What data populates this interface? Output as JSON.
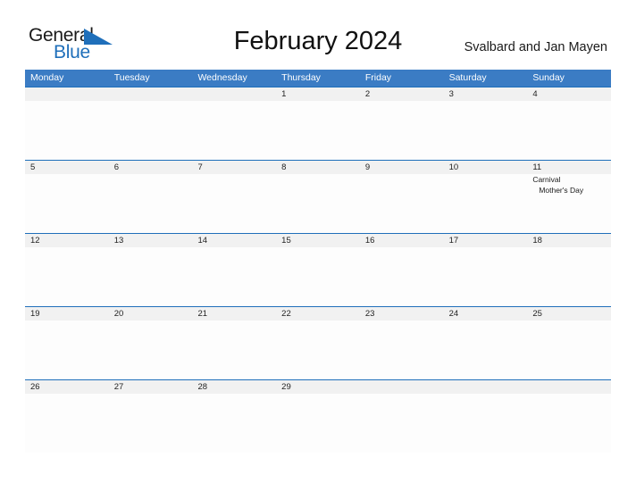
{
  "brand": {
    "name_top": "General",
    "name_bottom": "Blue",
    "triangle_icon": "triangle-flag-icon",
    "top_color": "#1a1a1a",
    "bottom_color": "#1f6fba"
  },
  "header": {
    "title": "February 2024",
    "region": "Svalbard and Jan Mayen"
  },
  "theme": {
    "header_blue": "#3b7cc4",
    "rule_blue": "#1f6fba",
    "date_band_gray": "#f1f1f1",
    "page_background": "#ffffff"
  },
  "calendar": {
    "weekdays": [
      "Monday",
      "Tuesday",
      "Wednesday",
      "Thursday",
      "Friday",
      "Saturday",
      "Sunday"
    ],
    "weeks": [
      {
        "days": [
          {
            "date": "",
            "events": []
          },
          {
            "date": "",
            "events": []
          },
          {
            "date": "",
            "events": []
          },
          {
            "date": "1",
            "events": []
          },
          {
            "date": "2",
            "events": []
          },
          {
            "date": "3",
            "events": []
          },
          {
            "date": "4",
            "events": []
          }
        ]
      },
      {
        "days": [
          {
            "date": "5",
            "events": []
          },
          {
            "date": "6",
            "events": []
          },
          {
            "date": "7",
            "events": []
          },
          {
            "date": "8",
            "events": []
          },
          {
            "date": "9",
            "events": []
          },
          {
            "date": "10",
            "events": []
          },
          {
            "date": "11",
            "events": [
              "Carnival",
              "Mother's Day"
            ]
          }
        ]
      },
      {
        "days": [
          {
            "date": "12",
            "events": []
          },
          {
            "date": "13",
            "events": []
          },
          {
            "date": "14",
            "events": []
          },
          {
            "date": "15",
            "events": []
          },
          {
            "date": "16",
            "events": []
          },
          {
            "date": "17",
            "events": []
          },
          {
            "date": "18",
            "events": []
          }
        ]
      },
      {
        "days": [
          {
            "date": "19",
            "events": []
          },
          {
            "date": "20",
            "events": []
          },
          {
            "date": "21",
            "events": []
          },
          {
            "date": "22",
            "events": []
          },
          {
            "date": "23",
            "events": []
          },
          {
            "date": "24",
            "events": []
          },
          {
            "date": "25",
            "events": []
          }
        ]
      },
      {
        "days": [
          {
            "date": "26",
            "events": []
          },
          {
            "date": "27",
            "events": []
          },
          {
            "date": "28",
            "events": []
          },
          {
            "date": "29",
            "events": []
          },
          {
            "date": "",
            "events": []
          },
          {
            "date": "",
            "events": []
          },
          {
            "date": "",
            "events": []
          }
        ]
      }
    ]
  }
}
